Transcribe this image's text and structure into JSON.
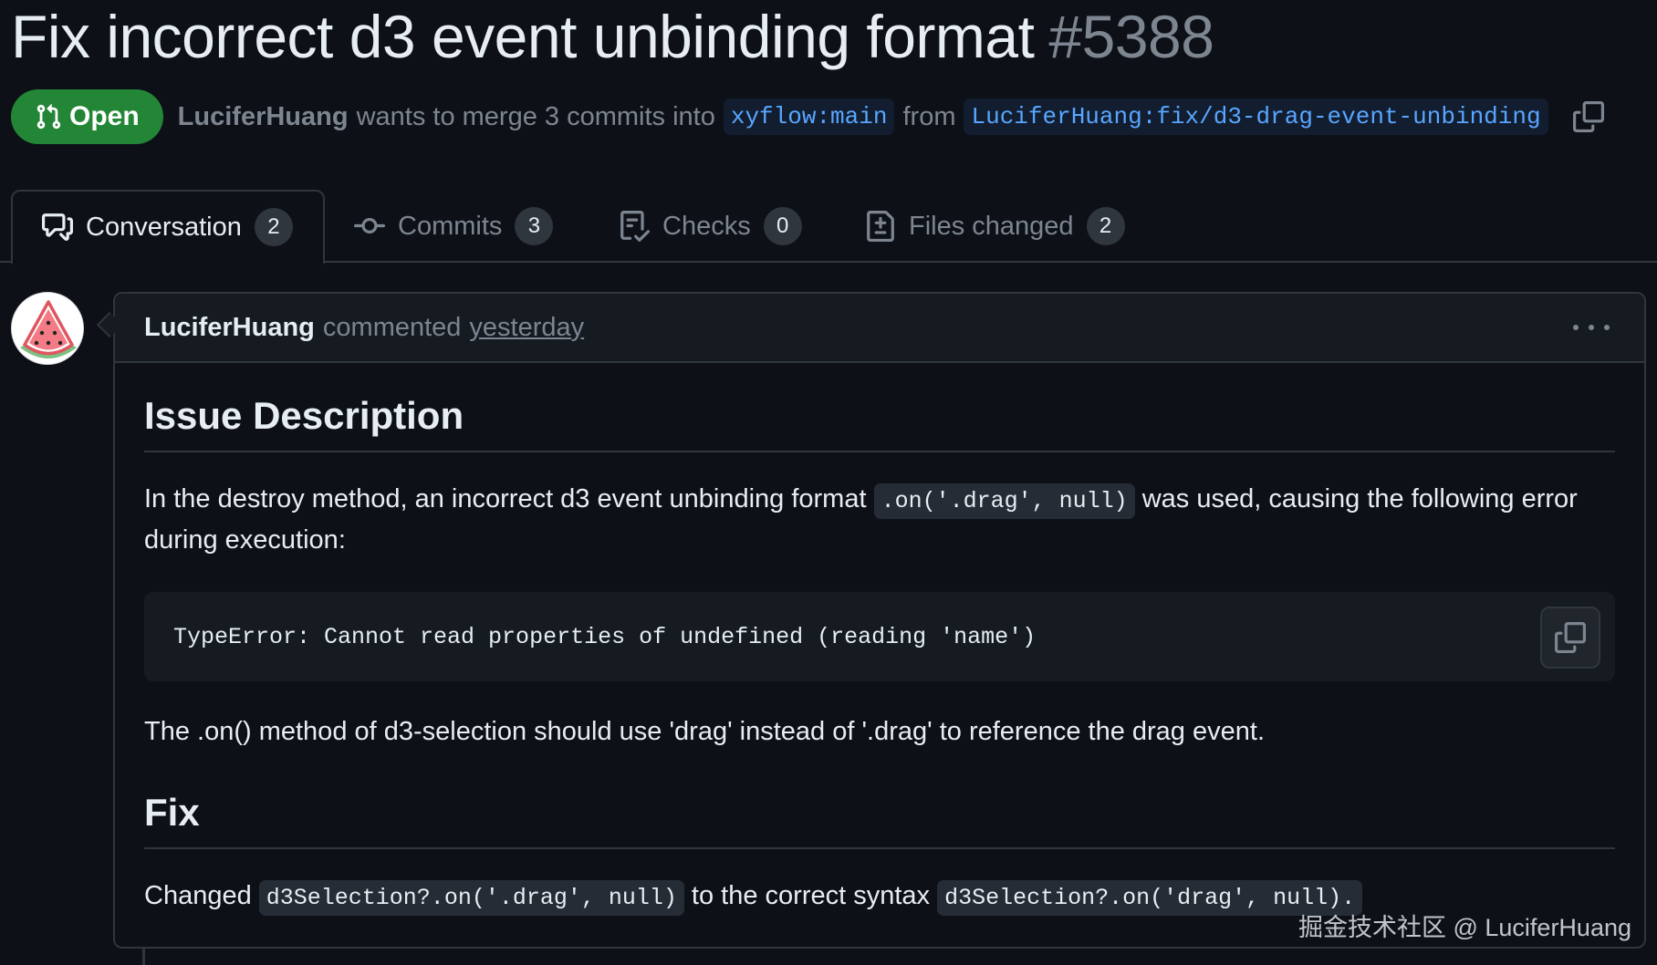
{
  "pr": {
    "title": "Fix incorrect d3 event unbinding format",
    "number": "#5388",
    "state": "Open",
    "author": "LuciferHuang",
    "merge_text": "wants to merge 3 commits into",
    "base_branch": "xyflow:main",
    "from_text": "from",
    "head_branch": "LuciferHuang:fix/d3-drag-event-unbinding"
  },
  "tabs": [
    {
      "label": "Conversation",
      "count": "2",
      "icon": "comment-discussion-icon"
    },
    {
      "label": "Commits",
      "count": "3",
      "icon": "git-commit-icon"
    },
    {
      "label": "Checks",
      "count": "0",
      "icon": "checklist-icon"
    },
    {
      "label": "Files changed",
      "count": "2",
      "icon": "file-diff-icon"
    }
  ],
  "comment": {
    "author": "LuciferHuang",
    "action": "commented",
    "time": "yesterday",
    "heading1": "Issue Description",
    "para1_pre": "In the destroy method, an incorrect d3 event unbinding format",
    "para1_code": ".on('.drag', null)",
    "para1_post": "was used, causing the following error during execution:",
    "code_block": "TypeError: Cannot read properties of undefined (reading 'name')",
    "para2": "The .on() method of d3-selection should use 'drag' instead of '.drag' to reference the drag event.",
    "heading2": "Fix",
    "para3_pre": "Changed",
    "para3_code1": "d3Selection?.on('.drag', null)",
    "para3_mid": "to the correct syntax",
    "para3_code2": "d3Selection?.on('drag', null)."
  },
  "watermark": "掘金技术社区 @ LuciferHuang",
  "colors": {
    "background": "#0d1117",
    "open_badge": "#238636",
    "branch_link": "#58a6ff",
    "border": "#30363d"
  }
}
